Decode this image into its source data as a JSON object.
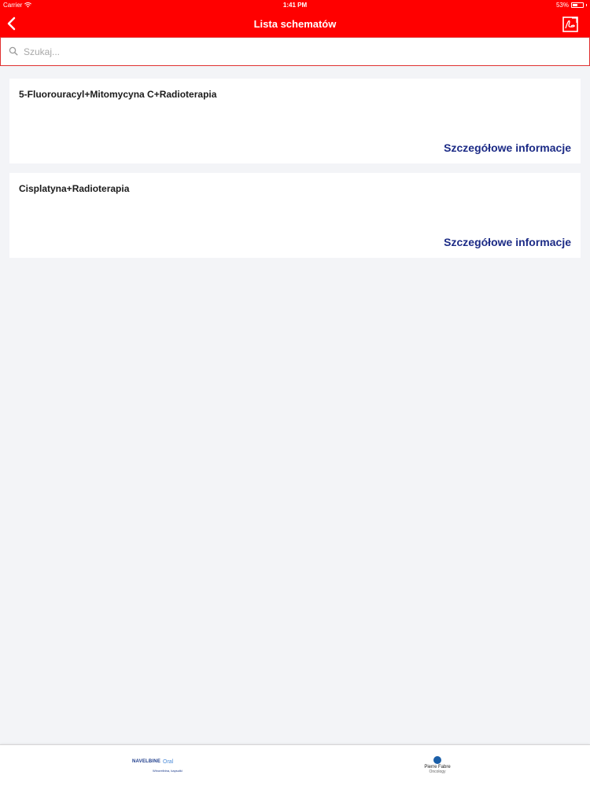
{
  "status_bar": {
    "carrier": "Carrier",
    "time": "1:41 PM",
    "battery": "53%",
    "battery_level": 0.53
  },
  "nav": {
    "title": "Lista schematów"
  },
  "search": {
    "placeholder": "Szukaj...",
    "value": ""
  },
  "items": [
    {
      "title": "5-Fluorouracyl+Mitomycyna C+Radioterapia",
      "link": "Szczegółowe informacje"
    },
    {
      "title": "Cisplatyna+Radioterapia",
      "link": "Szczegółowe informacje"
    }
  ],
  "footer": {
    "left_brand": "NAVELBINE",
    "left_brand_oral": "Oral",
    "left_brand_sub": "Winorelbina, kapsułki",
    "right_brand": "Pierre Fabre",
    "right_brand_sub": "Oncology"
  },
  "colors": {
    "accent": "#ff0000",
    "link": "#1c2b86",
    "background": "#f3f4f7"
  }
}
